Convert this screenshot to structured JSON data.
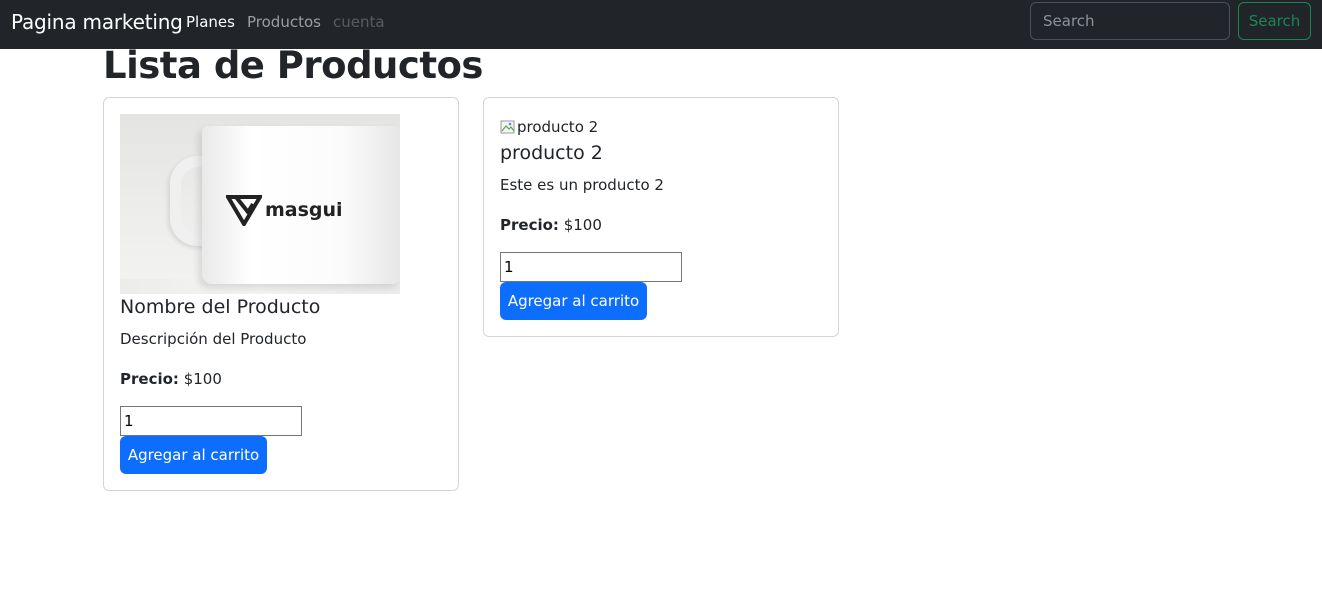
{
  "navbar": {
    "brand": "Pagina marketing",
    "links": [
      {
        "label": "Planes",
        "state": "active"
      },
      {
        "label": "Productos",
        "state": "normal"
      },
      {
        "label": "cuenta",
        "state": "disabled"
      }
    ],
    "search": {
      "placeholder": "Search",
      "value": ""
    },
    "search_button": "Search"
  },
  "page": {
    "title": "Lista de Productos"
  },
  "products": [
    {
      "image_alt": "",
      "image_logo_text": "masgui",
      "name": "Nombre del Producto",
      "description": "Descripción del Producto",
      "price_label": "Precio:",
      "price": "$100",
      "quantity": "1",
      "add_button": "Agregar al carrito"
    },
    {
      "image_alt": "producto 2",
      "name": "producto 2",
      "description": "Este es un producto 2",
      "price_label": "Precio:",
      "price": "$100",
      "quantity": "1",
      "add_button": "Agregar al carrito"
    }
  ],
  "colors": {
    "navbar_bg": "#212529",
    "primary": "#0d6efd",
    "success": "#198754"
  }
}
